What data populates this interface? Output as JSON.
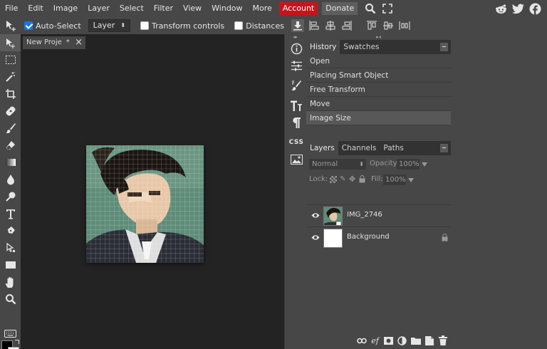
{
  "menu": {
    "items": [
      "File",
      "Edit",
      "Image",
      "Layer",
      "Select",
      "Filter",
      "View",
      "Window",
      "More"
    ],
    "account_label": "Account",
    "donate_label": "Donate"
  },
  "options": {
    "auto_select_label": "Auto-Select",
    "auto_select_checked": true,
    "target_select": "Layer",
    "transform_controls_label": "Transform controls",
    "distances_label": "Distances"
  },
  "document": {
    "tab_title": "New Proje",
    "tab_marker": "*"
  },
  "mini_toolbar": {
    "css_label": "CSS"
  },
  "history": {
    "tabs": [
      "History",
      "Swatches"
    ],
    "entries": [
      "Open",
      "Placing Smart Object",
      "Free Transform",
      "Move",
      "Image Size"
    ],
    "current_index": 4
  },
  "layers": {
    "tabs": [
      "Layers",
      "Channels",
      "Paths"
    ],
    "blend_mode": "Normal",
    "opacity_label": "Opacity:",
    "opacity_value": "100%",
    "lock_label": "Lock:",
    "fill_label": "Fill:",
    "fill_value": "100%",
    "items": [
      {
        "name": "IMG_2746",
        "locked": false
      },
      {
        "name": "Background",
        "locked": true
      }
    ]
  },
  "colors": {
    "accent": "#c9131b",
    "checkbox": "#1a73e8",
    "foreground_swatch": "#000000",
    "background_swatch": "#ffffff"
  },
  "footer_icons": [
    "link-icon",
    "effects-icon",
    "mask-icon",
    "adjustment-icon",
    "folder-icon",
    "new-layer-icon",
    "trash-icon"
  ]
}
